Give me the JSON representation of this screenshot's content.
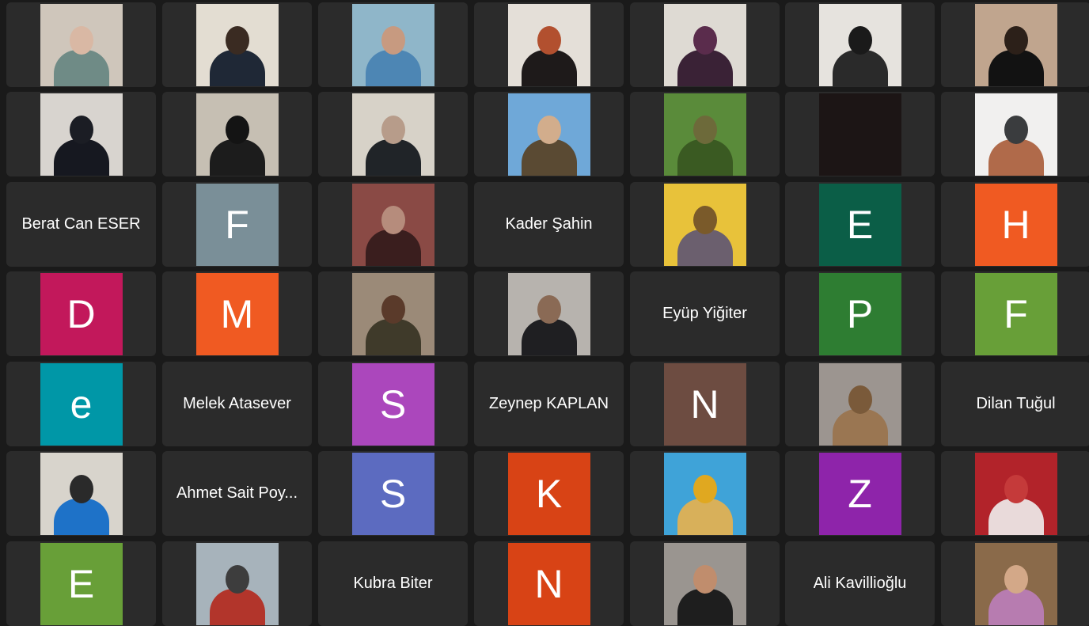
{
  "tiles": [
    {
      "type": "photo",
      "bg": "#cfc6bb",
      "fg": "#6f8b86",
      "head": "#d9b8a4"
    },
    {
      "type": "photo",
      "bg": "#e3ddd2",
      "fg": "#1f2836",
      "head": "#3a2b22"
    },
    {
      "type": "photo",
      "bg": "#8fb6c9",
      "fg": "#4d86b4",
      "head": "#c79a80"
    },
    {
      "type": "photo",
      "bg": "#e4dfd8",
      "fg": "#1e1a1a",
      "head": "#b2502f"
    },
    {
      "type": "photo",
      "bg": "#dedad3",
      "fg": "#3a2236",
      "head": "#5a2c4c"
    },
    {
      "type": "photo",
      "bg": "#e6e3de",
      "fg": "#2a2a2a",
      "head": "#1a1a1a"
    },
    {
      "type": "photo",
      "bg": "#c0a58e",
      "fg": "#121212",
      "head": "#2c2019"
    },
    {
      "type": "photo",
      "bg": "#d8d4cf",
      "fg": "#161820",
      "head": "#1b1d24"
    },
    {
      "type": "photo",
      "bg": "#c6bfb3",
      "fg": "#1c1c1c",
      "head": "#141414"
    },
    {
      "type": "photo",
      "bg": "#d7d2c8",
      "fg": "#202428",
      "head": "#b79c8a"
    },
    {
      "type": "photo",
      "bg": "#6fa8d8",
      "fg": "#5a4a33",
      "head": "#d2ad8c"
    },
    {
      "type": "photo",
      "bg": "#5a8b3a",
      "fg": "#3a5a22",
      "head": "#6d6a3a"
    },
    {
      "type": "blank",
      "bg": "#1c1515"
    },
    {
      "type": "photo",
      "bg": "#f1f0ef",
      "fg": "#b06a4a",
      "head": "#3a3c3e"
    },
    {
      "type": "name",
      "name": "Berat Can ESER"
    },
    {
      "type": "letter",
      "letter": "F",
      "color": "#7a8f98"
    },
    {
      "type": "photo",
      "bg": "#8a4a45",
      "fg": "#3a1e1e",
      "head": "#b68c7c"
    },
    {
      "type": "name",
      "name": "Kader Şahin"
    },
    {
      "type": "photo",
      "bg": "#e8c23a",
      "fg": "#6b5f6e",
      "head": "#7a5a2a"
    },
    {
      "type": "letter",
      "letter": "E",
      "color": "#0b5e47"
    },
    {
      "type": "letter",
      "letter": "H",
      "color": "#f05a22"
    },
    {
      "type": "letter",
      "letter": "D",
      "color": "#c2185b"
    },
    {
      "type": "letter",
      "letter": "M",
      "color": "#f05a22"
    },
    {
      "type": "photo",
      "bg": "#9b8a78",
      "fg": "#3f3a2a",
      "head": "#5a3a2a"
    },
    {
      "type": "photo",
      "bg": "#b7b3ae",
      "fg": "#1f1f22",
      "head": "#8a6a55"
    },
    {
      "type": "name",
      "name": "Eyüp Yiğiter"
    },
    {
      "type": "letter",
      "letter": "P",
      "color": "#2e7d32"
    },
    {
      "type": "letter",
      "letter": "F",
      "color": "#689f38"
    },
    {
      "type": "letter",
      "letter": "e",
      "color": "#0097a7"
    },
    {
      "type": "name",
      "name": "Melek Atasever"
    },
    {
      "type": "letter",
      "letter": "S",
      "color": "#ab47bc"
    },
    {
      "type": "name",
      "name": "Zeynep KAPLAN"
    },
    {
      "type": "letter",
      "letter": "N",
      "color": "#6d4c41"
    },
    {
      "type": "photo",
      "bg": "#9c9590",
      "fg": "#9a7652",
      "head": "#7a5a3a"
    },
    {
      "type": "name",
      "name": "Dilan Tuğul"
    },
    {
      "type": "photo",
      "bg": "#d8d4cc",
      "fg": "#1e72c8",
      "head": "#2a2a2a"
    },
    {
      "type": "name",
      "name": "Ahmet Sait Poy..."
    },
    {
      "type": "letter",
      "letter": "S",
      "color": "#5c6bc0"
    },
    {
      "type": "letter",
      "letter": "K",
      "color": "#d84315"
    },
    {
      "type": "photo",
      "bg": "#3fa3d8",
      "fg": "#d8b05a",
      "head": "#e0a820"
    },
    {
      "type": "letter",
      "letter": "Z",
      "color": "#8e24aa"
    },
    {
      "type": "photo",
      "bg": "#b2232a",
      "fg": "#e9dada",
      "head": "#c53a3a"
    },
    {
      "type": "letter",
      "letter": "E",
      "color": "#689f38"
    },
    {
      "type": "photo",
      "bg": "#a7b3bb",
      "fg": "#b2352b",
      "head": "#3d3d3d"
    },
    {
      "type": "name",
      "name": "Kubra Biter"
    },
    {
      "type": "letter",
      "letter": "N",
      "color": "#d84315"
    },
    {
      "type": "photo",
      "bg": "#9a9590",
      "fg": "#1e1e1e",
      "head": "#c08d6d"
    },
    {
      "type": "name",
      "name": "Ali Kavillioğlu"
    },
    {
      "type": "photo",
      "bg": "#8a6a4a",
      "fg": "#b77cb0",
      "head": "#d3a888"
    }
  ]
}
